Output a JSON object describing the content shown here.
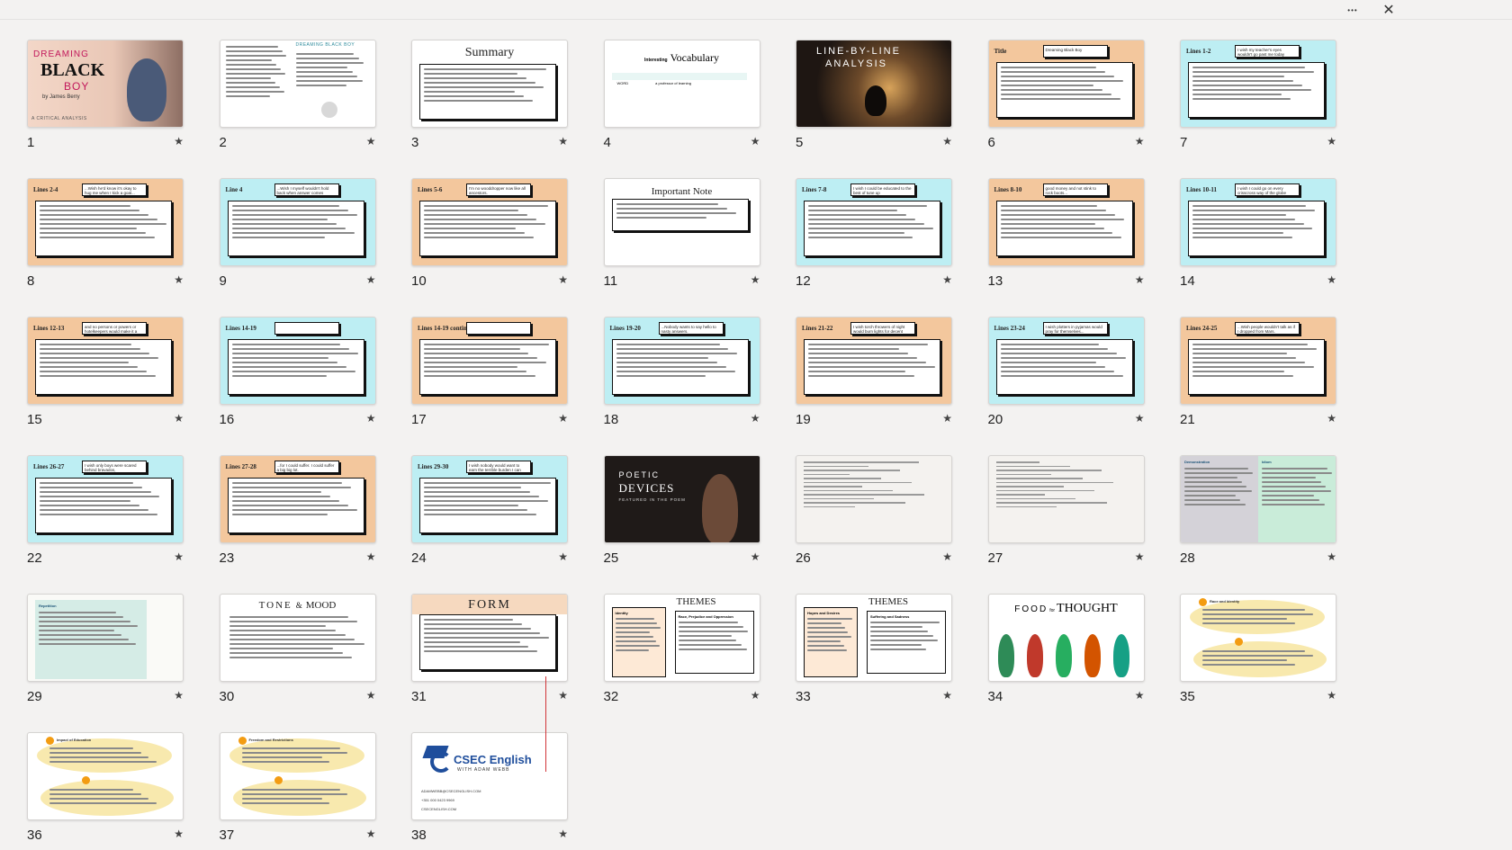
{
  "window": {
    "more_icon": "more-horizontal-icon",
    "close_icon": "close-icon",
    "more_glyph": "•••",
    "close_glyph": "✕"
  },
  "star_glyph": "★",
  "slides": [
    {
      "n": "1",
      "kind": "cover",
      "title": "BLACK",
      "pre": "DREAMING",
      "post": "BOY",
      "author": "by James Berry",
      "footer": "A CRITICAL ANALYSIS"
    },
    {
      "n": "2",
      "kind": "text2",
      "title": "DREAMING BLACK BOY"
    },
    {
      "n": "3",
      "kind": "titlebox",
      "title": "Summary"
    },
    {
      "n": "4",
      "kind": "titlebox-small",
      "title": "Vocabulary",
      "pre": "Interesting",
      "row": "WORD",
      "row2": "a professor of learning"
    },
    {
      "n": "5",
      "kind": "dark-photo",
      "title": "LINE-BY-LINE",
      "sub": "ANALYSIS"
    },
    {
      "n": "6",
      "kind": "lines",
      "color": "orange",
      "tag": "Title",
      "quote": "Dreaming Black Boy"
    },
    {
      "n": "7",
      "kind": "lines",
      "color": "cyan",
      "tag": "Lines 1-2",
      "quote": "I wish my teacher's eyes wouldn't go past me today"
    },
    {
      "n": "8",
      "kind": "lines",
      "color": "orange",
      "tag": "Lines 2-4",
      "quote": "...Wish he'd know it's okay to hug me when I kick a goal..."
    },
    {
      "n": "9",
      "kind": "lines",
      "color": "cyan",
      "tag": "Line 4",
      "quote": "...Wish I myself wouldn't hold back when answer comes"
    },
    {
      "n": "10",
      "kind": "lines",
      "color": "orange",
      "tag": "Lines 5-6",
      "quote": "I'm no wooddropper now like all ancestors."
    },
    {
      "n": "11",
      "kind": "note",
      "title": "Important Note"
    },
    {
      "n": "12",
      "kind": "lines",
      "color": "cyan",
      "tag": "Lines 7-8",
      "quote": "I wish I could be educated to the best of tune up"
    },
    {
      "n": "13",
      "kind": "lines",
      "color": "orange",
      "tag": "Lines 8-10",
      "quote": "good money and not stink to rock boots..."
    },
    {
      "n": "14",
      "kind": "lines",
      "color": "cyan",
      "tag": "Lines 10-11",
      "quote": "I wish I could go on every crisscross way of the globe"
    },
    {
      "n": "15",
      "kind": "lines",
      "color": "orange",
      "tag": "Lines 12-13",
      "quote": "and no persons or powers or hotelkeepers would make it a waste."
    },
    {
      "n": "16",
      "kind": "lines",
      "color": "cyan",
      "tag": "Lines 14-19",
      "quote": ""
    },
    {
      "n": "17",
      "kind": "lines",
      "color": "orange",
      "tag": "Lines 14-19 continued",
      "quote": ""
    },
    {
      "n": "18",
      "kind": "lines",
      "color": "cyan",
      "tag": "Lines 19-20",
      "quote": "...Nobody wants to say hello to nasty answers."
    },
    {
      "n": "19",
      "kind": "lines",
      "color": "orange",
      "tag": "Lines 21-22",
      "quote": "I wish torch throwers of night would burn lights for decent times."
    },
    {
      "n": "20",
      "kind": "lines",
      "color": "cyan",
      "tag": "Lines 23-24",
      "quote": "I wish plotters in pyjamas would pray for themselves..."
    },
    {
      "n": "21",
      "kind": "lines",
      "color": "orange",
      "tag": "Lines 24-25",
      "quote": "...Wish people wouldn't talk as if I dropped from Mars."
    },
    {
      "n": "22",
      "kind": "lines",
      "color": "cyan",
      "tag": "Lines 26-27",
      "quote": "I wish only boys were scared behind bravados,"
    },
    {
      "n": "23",
      "kind": "lines",
      "color": "orange",
      "tag": "Lines 27-28",
      "quote": "...for I could suffer. I could suffer a big big lot."
    },
    {
      "n": "24",
      "kind": "lines",
      "color": "cyan",
      "tag": "Lines 29-30",
      "quote": "I wish nobody would want to earn the terrible burden I can suffer."
    },
    {
      "n": "25",
      "kind": "dark-photo2",
      "title": "POETIC",
      "sub": "DEVICES",
      "foot": "FEATURED IN THE POEM"
    },
    {
      "n": "26",
      "kind": "sketch"
    },
    {
      "n": "27",
      "kind": "sketch"
    },
    {
      "n": "28",
      "kind": "columns",
      "left": "Demonstration",
      "right": "Idiom"
    },
    {
      "n": "29",
      "kind": "mint-card",
      "title": "Repetition"
    },
    {
      "n": "30",
      "kind": "tone",
      "title": "TONE",
      "amp": "&",
      "sub": "MOOD"
    },
    {
      "n": "31",
      "kind": "form",
      "title": "FORM"
    },
    {
      "n": "32",
      "kind": "themes",
      "title": "THEMES",
      "left": "Identity",
      "right": "Race, Prejudice and Oppression"
    },
    {
      "n": "33",
      "kind": "themes",
      "title": "THEMES",
      "left": "Hopes and Desires",
      "right": "Suffering and Sadness"
    },
    {
      "n": "34",
      "kind": "food",
      "title": "FOOD",
      "for": "for",
      "sub": "THOUGHT"
    },
    {
      "n": "35",
      "kind": "yellow",
      "title": "Race and Identity"
    },
    {
      "n": "36",
      "kind": "yellow",
      "title": "Impact of Education"
    },
    {
      "n": "37",
      "kind": "yellow",
      "title": "Freedom and Restrictions"
    },
    {
      "n": "38",
      "kind": "brand",
      "title": "CSEC English",
      "sub": "WITH ADAM WEBB",
      "email": "ADAMWEBB@CSECENGLISH.COM",
      "phone": "+351 000 0423 9969",
      "web": "CSECENGLISH.COM"
    }
  ]
}
